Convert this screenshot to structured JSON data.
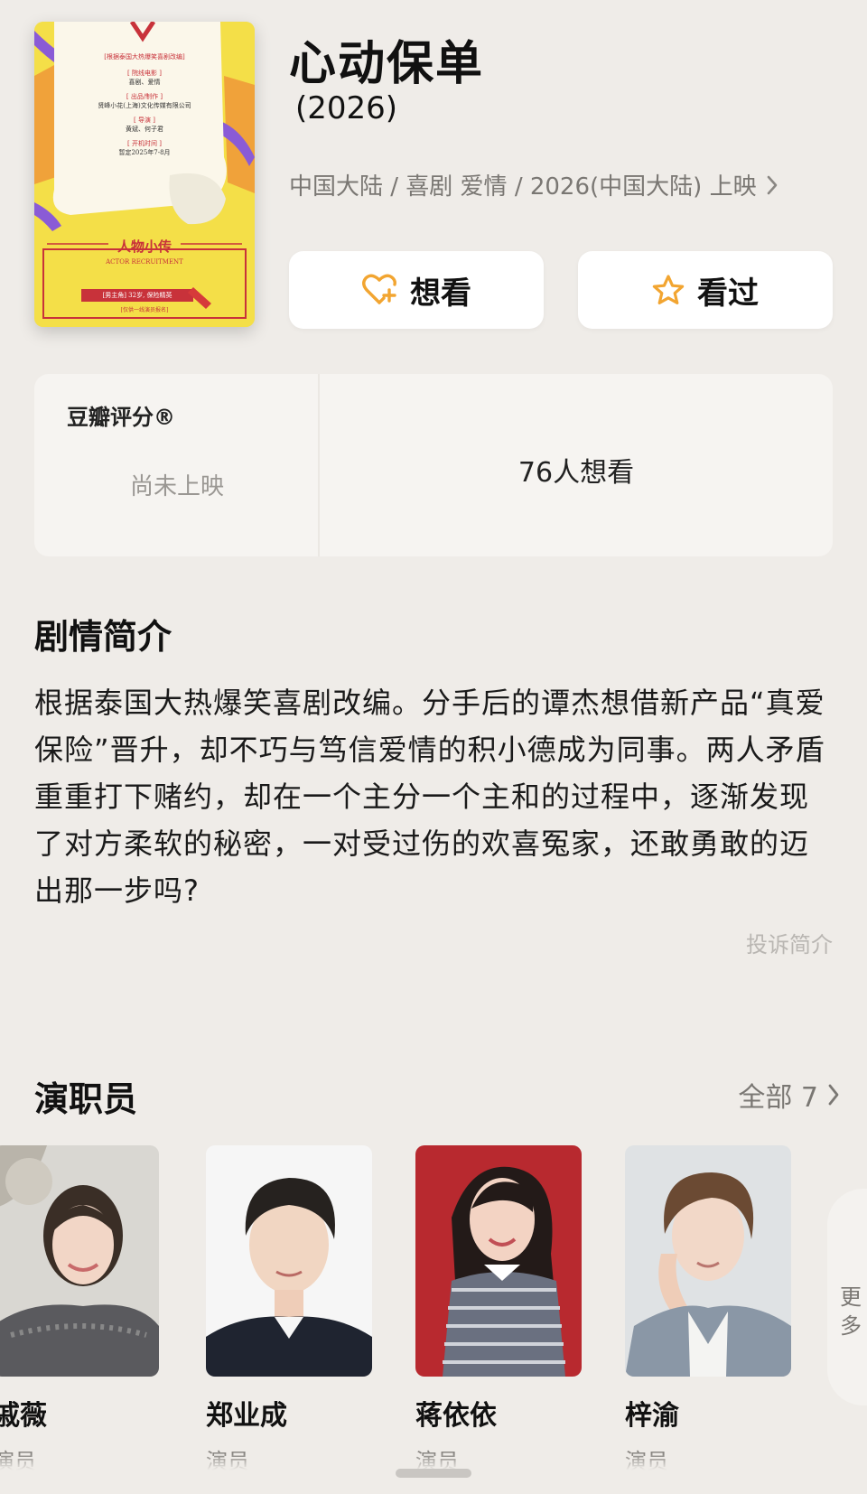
{
  "movie": {
    "title": "心动保单",
    "year": "(2026)",
    "meta": "中国大陆 / 喜剧 爱情 / 2026(中国大陆) 上映"
  },
  "poster": {
    "tagline": "[根据泰国大热爆笑喜剧改编]",
    "line1_head": "[ 院线电影 ]",
    "line1_body": "喜剧、爱情",
    "line2_head": "[ 出品/制作 ]",
    "line2_body": "贤峰小花(上海)文化传媒有限公司",
    "line3_head": "[ 导演 ]",
    "line3_body": "黄斌、何子君",
    "line4_head": "[ 开机时间 ]",
    "line4_body": "暂定2025年7-8月",
    "bio_title": "人物小传",
    "bio_subtitle": "ACTOR RECRUITMENT",
    "role_tag": "[男主角] 32岁, 保险精英",
    "bottom_tag": "[仅供一线演员报名]"
  },
  "actions": {
    "want_label": "想看",
    "seen_label": "看过"
  },
  "rating": {
    "label": "豆瓣评分®",
    "status": "尚未上映",
    "want_count": "76人想看"
  },
  "synopsis": {
    "title": "剧情简介",
    "text": "根据泰国大热爆笑喜剧改编。分手后的谭杰想借新产品“真爱保险”晋升，却不巧与笃信爱情的积小德成为同事。两人矛盾重重打下赌约，却在一个主分一个主和的过程中，逐渐发现了对方柔软的秘密，一对受过伤的欢喜冤家，还敢勇敢的迈出那一步吗?",
    "report_label": "投诉简介"
  },
  "cast": {
    "title": "演职员",
    "all_label": "全部 7",
    "more_label": "更多",
    "members": [
      {
        "name": "戚薇",
        "role": "演员"
      },
      {
        "name": "郑业成",
        "role": "演员"
      },
      {
        "name": "蒋依依",
        "role": "演员"
      },
      {
        "name": "梓渝",
        "role": "演员"
      }
    ]
  },
  "colors": {
    "background": "#efece8",
    "card": "#ffffff",
    "accent_orange": "#f2a531",
    "muted_text": "#7a7773"
  },
  "icons": {
    "want": "heart-plus-icon",
    "seen": "star-outline-icon",
    "meta_chevron": "chevron-right-icon",
    "cast_chevron": "chevron-right-icon"
  }
}
